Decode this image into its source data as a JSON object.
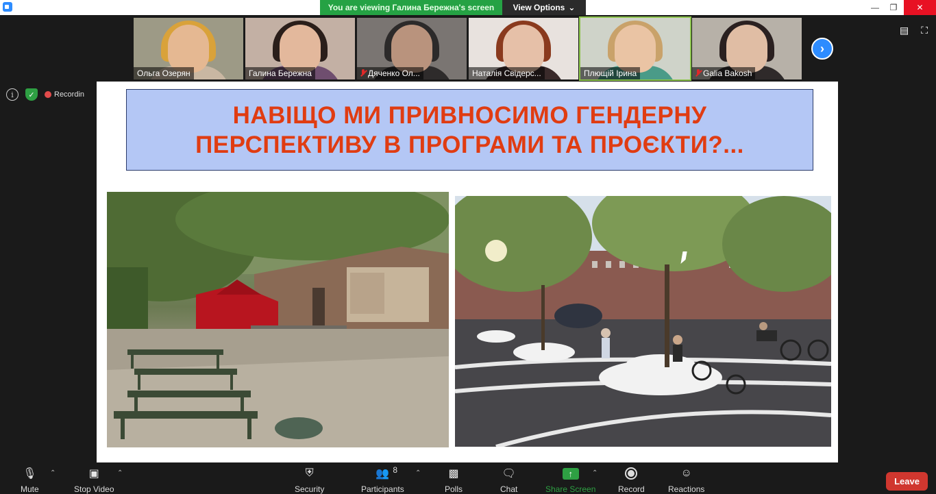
{
  "banner": {
    "viewing_text": "You are viewing Галина Бережна's screen",
    "view_options": "View Options"
  },
  "participants": [
    {
      "name": "Ольга Озерян",
      "muted": false,
      "skin": "#e5b892",
      "hair": "#d9a23a",
      "bg": "#9d9a86",
      "body": "#c9b7a2",
      "active": false
    },
    {
      "name": "Галина Бережна",
      "muted": false,
      "skin": "#e3b89c",
      "hair": "#2a1e1a",
      "bg": "#c3b0a4",
      "body": "#6f4e6f",
      "active": false
    },
    {
      "name": "Дяченко Ол...",
      "muted": true,
      "skin": "#b9937d",
      "hair": "#2c2a2a",
      "bg": "#7a7572",
      "body": "#2e2b2b",
      "active": false
    },
    {
      "name": "Наталія Свідерс...",
      "muted": false,
      "skin": "#e6c0a8",
      "hair": "#8a3a1e",
      "bg": "#e8e2de",
      "body": "#3a2a2a",
      "active": false
    },
    {
      "name": "Плющій Ірина",
      "muted": false,
      "skin": "#eac4a4",
      "hair": "#c9a26a",
      "bg": "#cfd3c9",
      "body": "#4a9b88",
      "active": true
    },
    {
      "name": "Galia Bakosh",
      "muted": true,
      "skin": "#e0bda4",
      "hair": "#2a2020",
      "bg": "#b7b1a8",
      "body": "#2f2a2a",
      "active": false
    }
  ],
  "indicators": {
    "recording": "Recordin"
  },
  "slide": {
    "title_line1": "НАВІЩО МИ ПРИВНОСИМО ГЕНДЕРНУ",
    "title_line2": "ПЕРСПЕКТИВУ В ПРОГРАМИ ТА ПРОЄКТИ?..."
  },
  "toolbar": {
    "mute": "Mute",
    "stop_video": "Stop Video",
    "security": "Security",
    "participants": "Participants",
    "participants_count": "8",
    "polls": "Polls",
    "chat": "Chat",
    "share_screen": "Share Screen",
    "record": "Record",
    "reactions": "Reactions",
    "leave": "Leave"
  },
  "icons": {
    "app": "zoom-icon",
    "info": "info-icon",
    "security": "shield-icon",
    "next": "chevron-right-icon",
    "mic": "microphone-icon",
    "video": "video-camera-icon",
    "people": "people-icon",
    "polls": "bar-chart-icon",
    "chat": "speech-bubble-icon",
    "share": "share-screen-icon",
    "record": "record-icon",
    "reactions": "emoji-icon"
  },
  "colors": {
    "slide_title": "#e03c12",
    "slide_title_bg": "#b4c7f5",
    "banner_green": "#25a244",
    "leave_red": "#d0372f",
    "accent_blue": "#2d8cff"
  }
}
